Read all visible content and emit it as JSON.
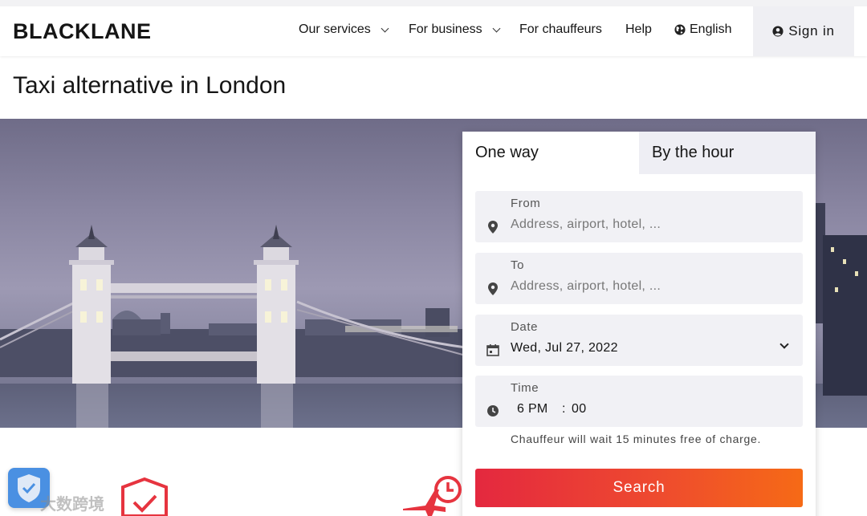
{
  "header": {
    "logo": "BLACKLANE",
    "nav": [
      {
        "label": "Our services",
        "dropdown": true
      },
      {
        "label": "For business",
        "dropdown": true
      },
      {
        "label": "For chauffeurs",
        "dropdown": false
      },
      {
        "label": "Help",
        "dropdown": false
      },
      {
        "label": "English",
        "icon": "globe-icon"
      }
    ],
    "signin_label": "Sign in"
  },
  "page": {
    "title": "Taxi alternative in London"
  },
  "booking": {
    "tabs": [
      {
        "label": "One way",
        "active": true
      },
      {
        "label": "By the hour",
        "active": false
      }
    ],
    "from": {
      "label": "From",
      "placeholder": "Address, airport, hotel, ..."
    },
    "to": {
      "label": "To",
      "placeholder": "Address, airport, hotel, ..."
    },
    "date": {
      "label": "Date",
      "value": "Wed, Jul 27, 2022"
    },
    "time": {
      "label": "Time",
      "hour": "6 PM",
      "separator": ":",
      "minute": "00"
    },
    "note": "Chauffeur will wait 15 minutes free of charge.",
    "search_label": "Search"
  },
  "watermark": "大数跨境",
  "colors": {
    "accent_start": "#e4283f",
    "accent_end": "#f66a16",
    "feature_icon": "#e6343f"
  }
}
